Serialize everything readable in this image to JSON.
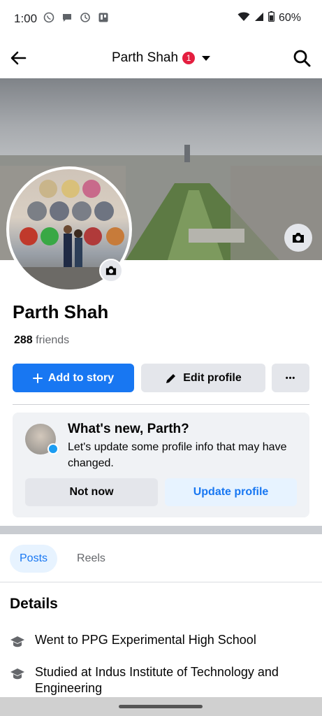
{
  "status_bar": {
    "time": "1:00",
    "battery": "60%"
  },
  "header": {
    "title": "Parth Shah",
    "notification_count": "1"
  },
  "profile": {
    "name": "Parth Shah",
    "friends_count": "288",
    "friends_label": "friends"
  },
  "actions": {
    "add_story_label": "Add to story",
    "edit_profile_label": "Edit profile",
    "more_label": "•••"
  },
  "whats_new": {
    "title": "What's new, Parth?",
    "text": "Let's update some profile info that may have changed.",
    "not_now_label": "Not now",
    "update_label": "Update profile"
  },
  "tabs": [
    {
      "label": "Posts",
      "active": true
    },
    {
      "label": "Reels",
      "active": false
    }
  ],
  "details": {
    "title": "Details",
    "items": [
      {
        "icon": "graduation-cap-icon",
        "text": "Went to PPG Experimental High School"
      },
      {
        "icon": "graduation-cap-icon",
        "text": "Studied at Indus Institute of Technology and Engineering"
      }
    ]
  },
  "colors": {
    "primary": "#1877f2",
    "badge": "#e41e3f",
    "secondary_button": "#e4e6eb",
    "card_bg": "#f0f2f5"
  }
}
